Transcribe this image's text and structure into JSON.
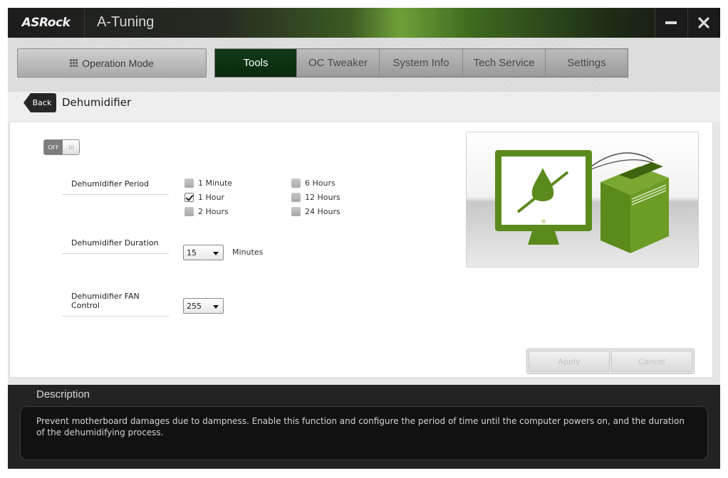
{
  "titlebar": {
    "brand": "ASRock",
    "app_title": "A-Tuning"
  },
  "nav": {
    "operation_mode": "Operation Mode",
    "tabs": [
      "Tools",
      "OC Tweaker",
      "System Info",
      "Tech Service",
      "Settings"
    ],
    "active_tab": "Tools"
  },
  "breadcrumb": {
    "back_label": "Back",
    "page_title": "Dehumidifier"
  },
  "toggle": {
    "state_label": "OFF",
    "knob_label": "III"
  },
  "period": {
    "label": "Dehumidifier Period",
    "options": [
      {
        "label": "1 Minute",
        "checked": false
      },
      {
        "label": "1 Hour",
        "checked": true
      },
      {
        "label": "2 Hours",
        "checked": false
      },
      {
        "label": "6 Hours",
        "checked": false
      },
      {
        "label": "12 Hours",
        "checked": false
      },
      {
        "label": "24 Hours",
        "checked": false
      }
    ]
  },
  "duration": {
    "label": "Dehumidifier Duration",
    "value": "15",
    "unit": "Minutes"
  },
  "fan": {
    "label": "Dehumidifier FAN Control",
    "value": "255"
  },
  "actions": {
    "apply": "Apply",
    "cancel": "Cancel"
  },
  "description": {
    "title": "Description",
    "text": "Prevent motherboard damages due to dampness. Enable this function and configure the period of time until the computer powers on, and the duration of the dehumidifying process."
  },
  "colors": {
    "accent": "#5c8a1e",
    "active_tab": "#0c3212"
  }
}
